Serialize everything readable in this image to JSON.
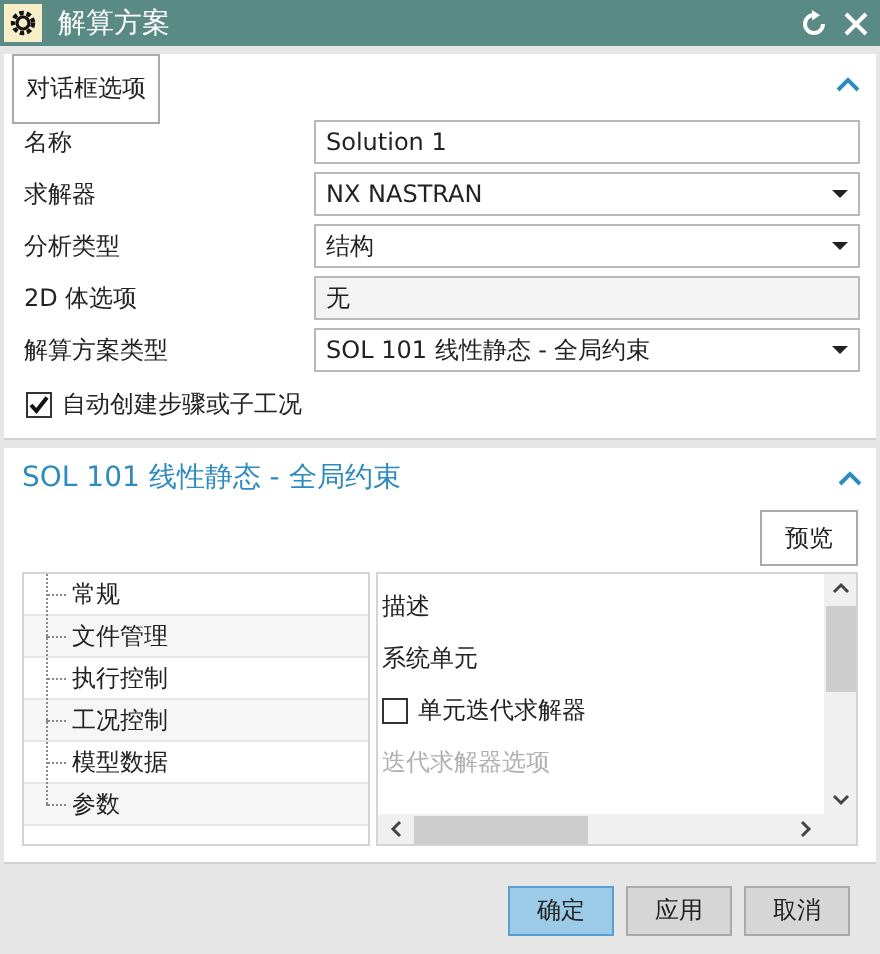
{
  "window": {
    "title": "解算方案"
  },
  "dialog_options": {
    "label": "对话框选项",
    "expanded": true
  },
  "fields": [
    {
      "kind": "text",
      "label": "名称",
      "value": "Solution 1"
    },
    {
      "kind": "dropdown",
      "label": "求解器",
      "value": "NX NASTRAN"
    },
    {
      "kind": "dropdown",
      "label": "分析类型",
      "value": "结构"
    },
    {
      "kind": "readonly",
      "label": "2D 体选项",
      "value": "无"
    },
    {
      "kind": "dropdown",
      "label": "解算方案类型",
      "value": "SOL 101 线性静态 - 全局约束"
    }
  ],
  "auto_create": {
    "label": "自动创建步骤或子工况",
    "checked": true
  },
  "solution_section": {
    "title": "SOL 101 线性静态 - 全局约束",
    "expanded": true,
    "preview_button": "预览",
    "tree": [
      {
        "label": "常规"
      },
      {
        "label": "文件管理"
      },
      {
        "label": "执行控制"
      },
      {
        "label": "工况控制"
      },
      {
        "label": "模型数据"
      },
      {
        "label": "参数"
      }
    ],
    "properties": [
      {
        "kind": "heading",
        "label": "描述"
      },
      {
        "kind": "heading",
        "label": "系统单元"
      },
      {
        "kind": "checkbox",
        "label": "单元迭代求解器",
        "checked": false
      },
      {
        "kind": "disabled",
        "label": "迭代求解器选项"
      }
    ]
  },
  "buttons": [
    {
      "label": "确定",
      "kind": "primary"
    },
    {
      "label": "应用",
      "kind": "normal"
    },
    {
      "label": "取消",
      "kind": "normal"
    }
  ]
}
